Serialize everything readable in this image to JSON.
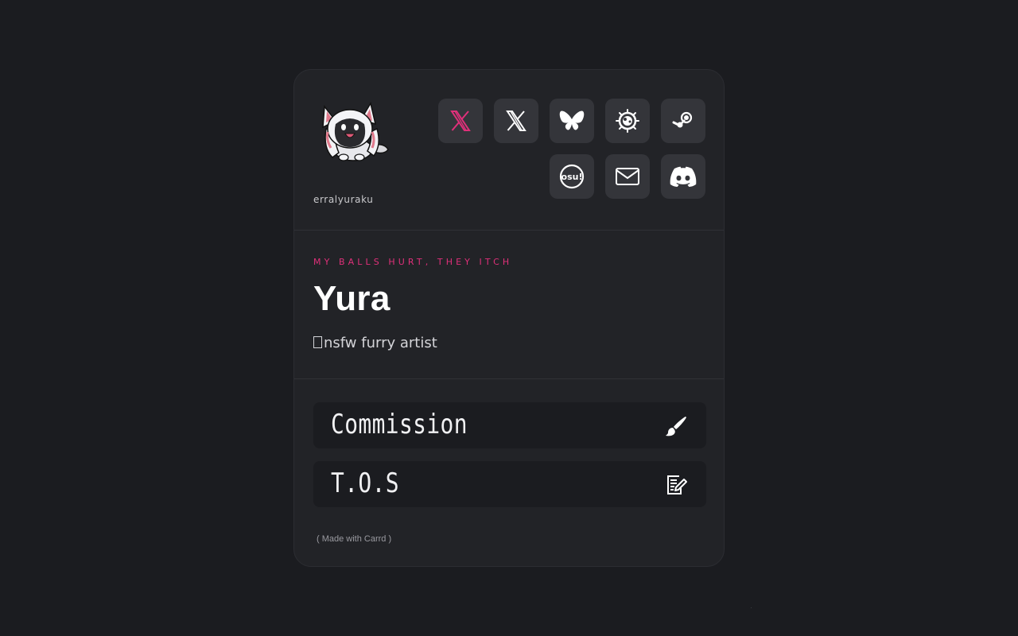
{
  "profile": {
    "username": "erralyuraku",
    "tagline": "MY BALLS HURT, THEY ITCH",
    "name": "Yura",
    "bio": "nsfw furry artist"
  },
  "social_icons": [
    {
      "name": "x-icon-pink",
      "color": "#e0307a"
    },
    {
      "name": "x-icon",
      "color": "#ffffff"
    },
    {
      "name": "bluesky-icon",
      "color": "#ffffff"
    },
    {
      "name": "splat-icon",
      "color": "#ffffff"
    },
    {
      "name": "steam-icon",
      "color": "#ffffff"
    },
    {
      "name": "osu-icon",
      "color": "#ffffff",
      "text": "osu!"
    },
    {
      "name": "mail-icon",
      "color": "#ffffff"
    },
    {
      "name": "discord-icon",
      "color": "#ffffff"
    }
  ],
  "links": [
    {
      "label": "Commission",
      "icon": "paintbrush-icon"
    },
    {
      "label": "T.O.S",
      "icon": "document-edit-icon"
    }
  ],
  "footer": {
    "text": "( Made with Carrd )"
  },
  "colors": {
    "background": "#1b1c20",
    "card": "#222327",
    "accent": "#e0307a",
    "icon_button": "#34353a"
  }
}
